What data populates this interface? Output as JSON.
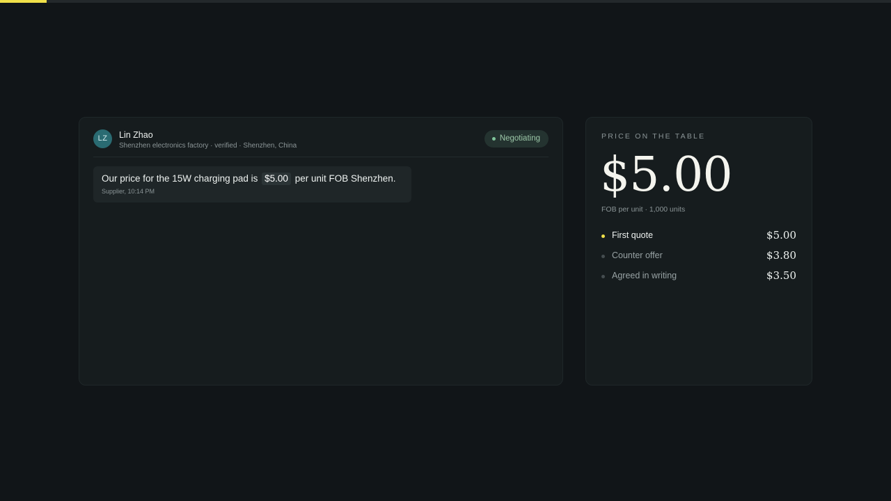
{
  "progress": {
    "fraction": 0.052,
    "color": "#f0e04a"
  },
  "contact": {
    "initials": "LZ",
    "name": "Lin Zhao",
    "meta": "Shenzhen electronics factory · verified · Shenzhen, China",
    "status": "Negotiating"
  },
  "message": {
    "before": "Our price for the 15W charging pad is",
    "price": "$5.00",
    "after": "per unit FOB Shenzhen.",
    "time": "Supplier, 10:14 PM"
  },
  "price_panel": {
    "label": "PRICE ON THE TABLE",
    "price": "$5.00",
    "sub": "FOB per unit · 1,000 units",
    "history": [
      {
        "label": "First quote",
        "value": "$5.00",
        "active": true
      },
      {
        "label": "Counter offer",
        "value": "$3.80",
        "active": false
      },
      {
        "label": "Agreed in writing",
        "value": "$3.50",
        "active": false
      }
    ]
  }
}
